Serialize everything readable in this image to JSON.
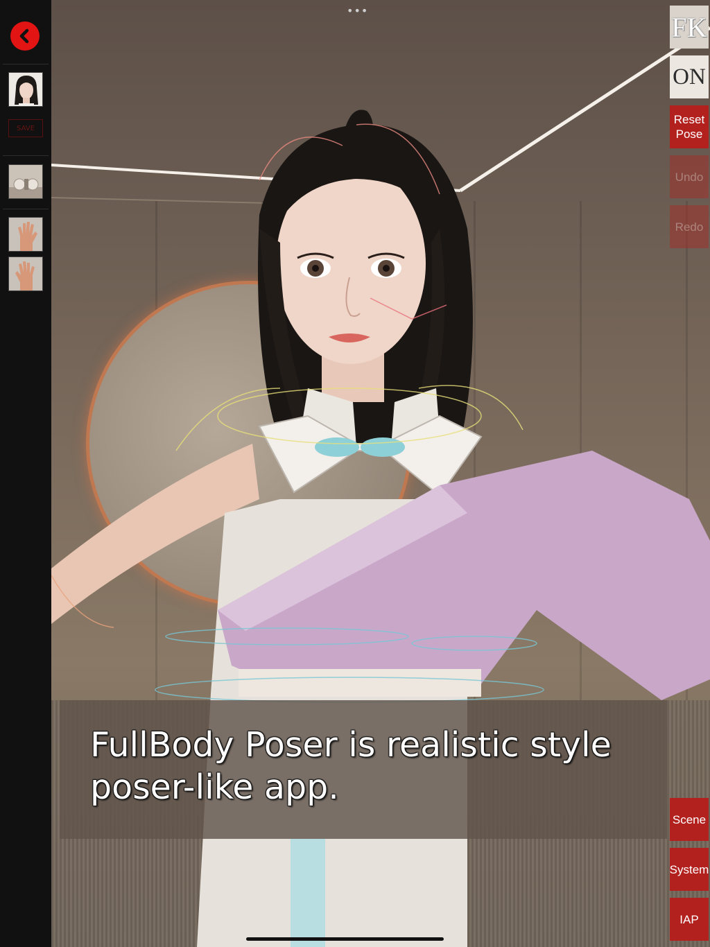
{
  "left_sidebar": {
    "back_icon": "chevron-left-icon",
    "save_badge": "SAVE",
    "thumbnails": [
      "character-portrait",
      "room-scene",
      "left-hand",
      "right-hand"
    ]
  },
  "right_toolbar": {
    "fk_label": "FK",
    "on_label": "ON",
    "reset_pose_label": "Reset Pose",
    "undo_label": "Undo",
    "redo_label": "Redo",
    "scene_label": "Scene",
    "system_label": "System",
    "iap_label": "IAP"
  },
  "caption": {
    "line1": "FullBody Poser is realistic style",
    "line2": "poser-like app."
  },
  "system": {
    "top_dots": "•••"
  },
  "colors": {
    "accent_red": "#b3211e",
    "back_red": "#e21414",
    "sidebar_bg": "#111111"
  }
}
